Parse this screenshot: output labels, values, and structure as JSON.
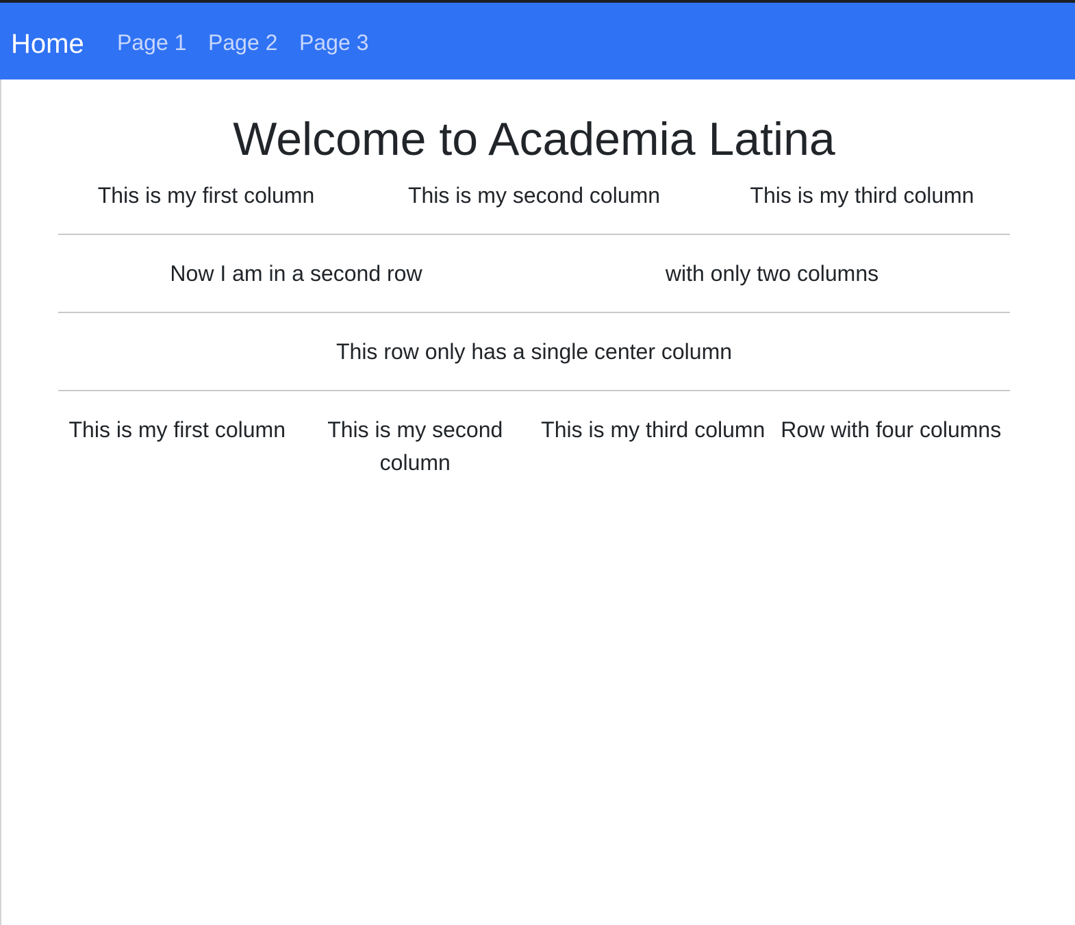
{
  "navbar": {
    "brand": "Home",
    "links": [
      {
        "label": "Page 1"
      },
      {
        "label": "Page 2"
      },
      {
        "label": "Page 3"
      }
    ],
    "background_color": "#2f72f4",
    "link_color": "#c8d7fb"
  },
  "main": {
    "title": "Welcome to Academia Latina",
    "rows": [
      {
        "columns": [
          "This is my first column",
          "This is my second column",
          "This is my third column"
        ]
      },
      {
        "columns": [
          "Now I am in a second row",
          "with only two columns"
        ]
      },
      {
        "columns": [
          "This row only has a single center column"
        ]
      },
      {
        "columns": [
          "This is my first column",
          "This is my second column",
          "This is my third column",
          "Row with four columns"
        ]
      }
    ]
  }
}
